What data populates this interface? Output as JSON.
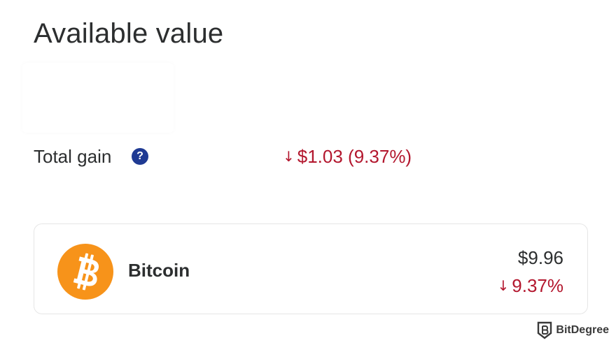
{
  "header": {
    "title": "Available value"
  },
  "summary": {
    "total_gain_label": "Total gain",
    "help_icon_glyph": "?",
    "total_gain_arrow": "↓",
    "total_gain_value": "$1.03 (9.37%)",
    "gain_color": "#b3172e"
  },
  "assets": [
    {
      "name": "Bitcoin",
      "icon": "bitcoin-icon",
      "icon_color": "#f7931a",
      "price": "$9.96",
      "change_arrow": "↓",
      "change": "9.37%"
    }
  ],
  "watermark": {
    "text": "BitDegree"
  }
}
